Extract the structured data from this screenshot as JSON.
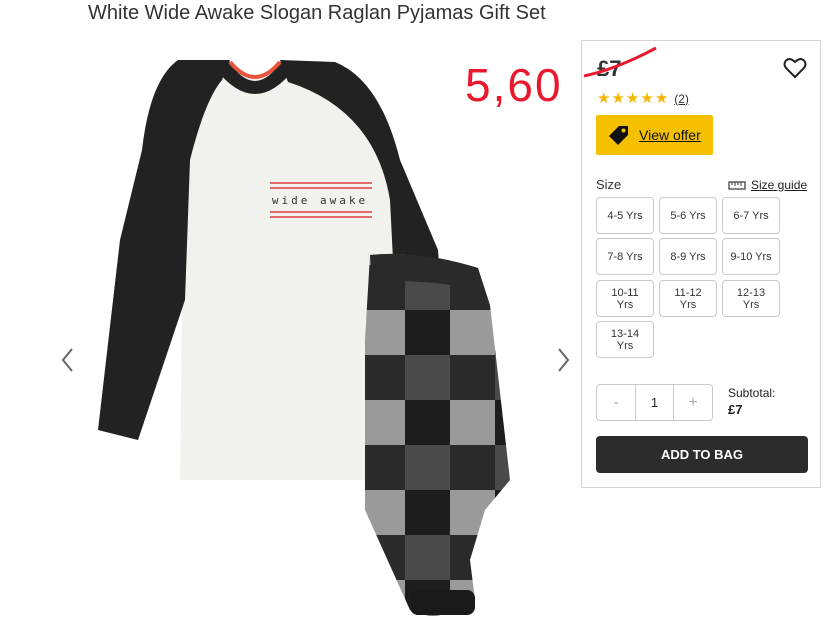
{
  "product": {
    "title": "White Wide Awake Slogan Raglan Pyjamas Gift Set",
    "image_slogan": "wide awake"
  },
  "annotation": {
    "new_price": "5,60",
    "color": "#e8192c"
  },
  "panel": {
    "old_price": "£7",
    "rating": {
      "stars": 5,
      "max": 5,
      "count_label": "(2)"
    },
    "offer": {
      "label": "View offer",
      "color": "#f5c000",
      "icon": "tag-icon"
    },
    "size": {
      "label": "Size",
      "guide_label": "Size guide",
      "guide_icon": "ruler-icon",
      "options": [
        "4-5 Yrs",
        "5-6 Yrs",
        "6-7 Yrs",
        "7-8 Yrs",
        "8-9 Yrs",
        "9-10 Yrs",
        "10-11 Yrs",
        "11-12 Yrs",
        "12-13 Yrs",
        "13-14 Yrs"
      ]
    },
    "quantity": {
      "minus": "-",
      "value": "1",
      "plus": "+"
    },
    "subtotal": {
      "label": "Subtotal:",
      "value": "£7"
    },
    "add_to_bag": "ADD TO BAG"
  }
}
